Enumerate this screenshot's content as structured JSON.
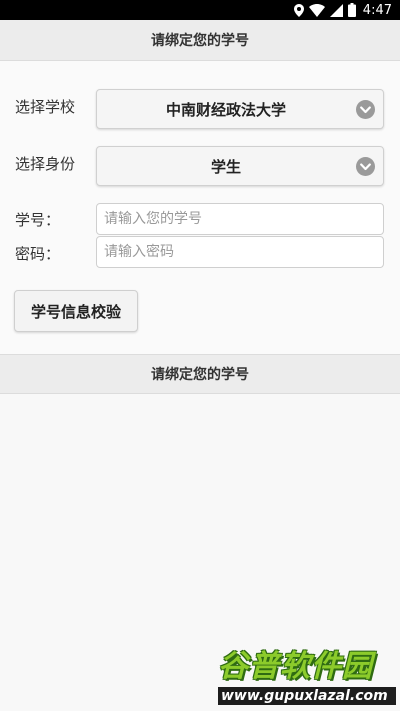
{
  "status_bar": {
    "time": "4:47",
    "icons": [
      "location-icon",
      "wifi-icon",
      "signal-icon",
      "battery-icon"
    ]
  },
  "header": {
    "title": "请绑定您的学号"
  },
  "form": {
    "school": {
      "label": "选择学校",
      "value": "中南财经政法大学"
    },
    "identity": {
      "label": "选择身份",
      "value": "学生"
    },
    "student_id": {
      "label": "学号：",
      "placeholder": "请输入您的学号",
      "value": ""
    },
    "password": {
      "label": "密码：",
      "placeholder": "请输入密码",
      "value": ""
    },
    "verify_button_label": "学号信息校验"
  },
  "footer_bar": {
    "title": "请绑定您的学号"
  },
  "watermark": {
    "title": "谷普软件园",
    "url": "www.gupuxlazal.com"
  },
  "colors": {
    "header_bg": "#ececec",
    "page_bg": "#f8f8f8",
    "chevron_bg": "#9a9a9a",
    "watermark_green": "#8ccb2b"
  }
}
